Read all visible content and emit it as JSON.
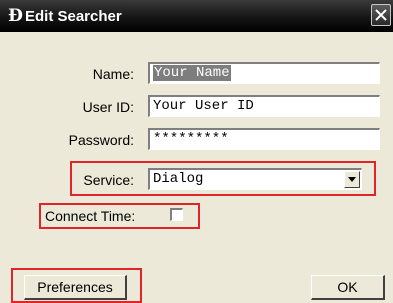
{
  "window": {
    "title": "Edit Searcher",
    "icon_glyph": "Ɖ"
  },
  "form": {
    "name_label": "Name:",
    "name_value": "Your Name",
    "userid_label": "User ID:",
    "userid_value": "Your User ID",
    "password_label": "Password:",
    "password_value": "*********",
    "service_label": "Service:",
    "service_value": "Dialog",
    "connect_time_label": "Connect Time:",
    "connect_time_checked": false
  },
  "buttons": {
    "preferences": "Preferences",
    "ok": "OK"
  },
  "colors": {
    "highlight": "#e0242a",
    "titlebar": "#151515",
    "dialog": "#ece9d8"
  },
  "icons": {
    "close": "close-icon",
    "app": "app-logo-icon",
    "dropdown": "chevron-down-icon"
  }
}
